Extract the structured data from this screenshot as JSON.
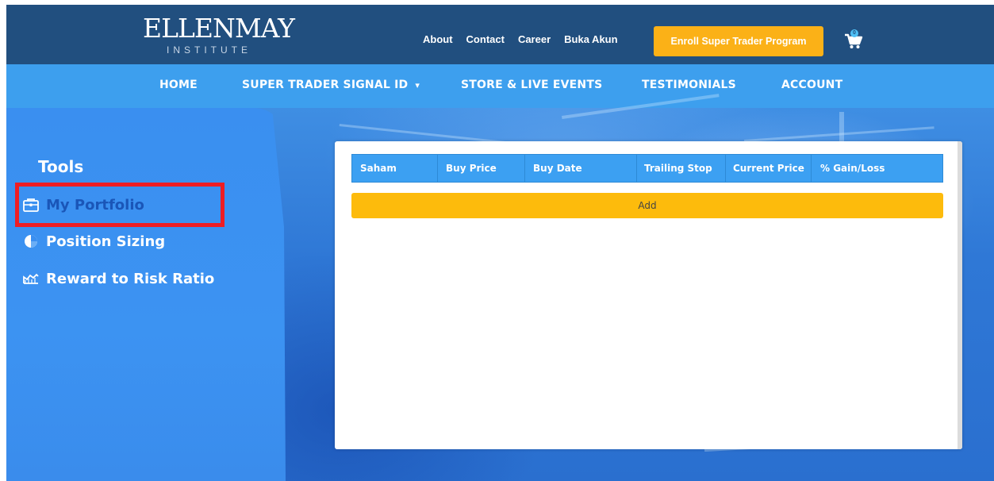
{
  "brand": {
    "logo_main": "ELLENMAY",
    "logo_sub": "INSTITUTE"
  },
  "top_links": [
    "About",
    "Contact",
    "Career",
    "Buka Akun"
  ],
  "enroll_button": "Enroll Super Trader Program",
  "cart_count": "0",
  "nav": {
    "home": "HOME",
    "signal": "SUPER TRADER SIGNAL ID",
    "signal_caret": "▾",
    "store": "STORE & LIVE EVENTS",
    "testimonials": "TESTIMONIALS",
    "account": "ACCOUNT"
  },
  "sidebar": {
    "title": "Tools",
    "items": [
      {
        "label": "My Portfolio",
        "icon": "briefcase-icon"
      },
      {
        "label": "Position Sizing",
        "icon": "pie-chart-icon"
      },
      {
        "label": "Reward to Risk Ratio",
        "icon": "chart-icon"
      }
    ]
  },
  "table": {
    "columns": [
      "Saham",
      "Buy Price",
      "Buy Date",
      "Trailing Stop",
      "Current Price",
      "% Gain/Loss"
    ],
    "add_label": "Add"
  },
  "colors": {
    "topbar": "#214f7f",
    "navbar": "#3d9fee",
    "accent_yellow": "#fbb117",
    "highlight_red": "#ee1d24"
  }
}
